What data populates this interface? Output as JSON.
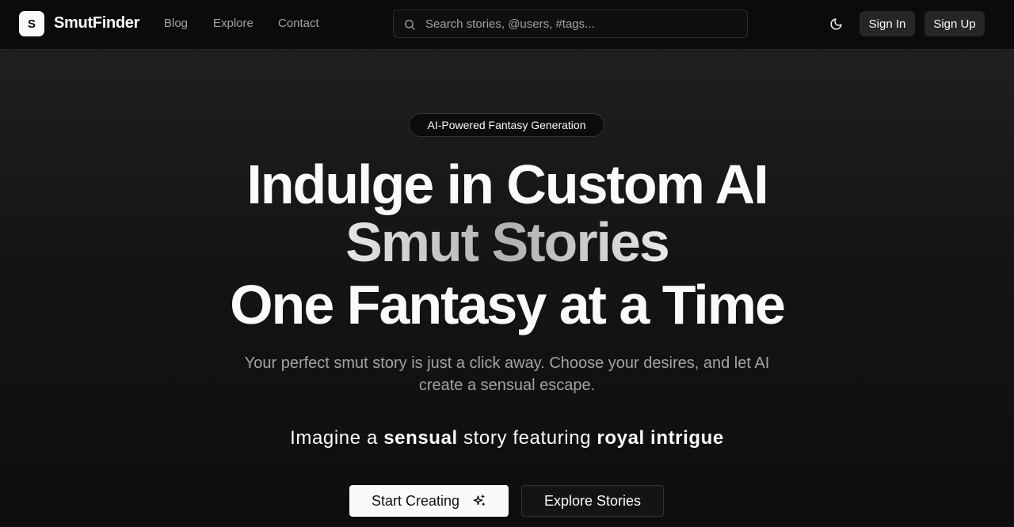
{
  "header": {
    "logo_letter": "S",
    "brand": "SmutFinder",
    "nav": [
      {
        "label": "Blog"
      },
      {
        "label": "Explore"
      },
      {
        "label": "Contact"
      }
    ],
    "search": {
      "placeholder": "Search stories, @users, #tags...",
      "icon": "search-icon"
    },
    "theme_toggle_icon": "moon-icon",
    "sign_in": "Sign In",
    "sign_up": "Sign Up"
  },
  "hero": {
    "badge": "AI-Powered Fantasy Generation",
    "headline_line1": "Indulge in Custom AI",
    "headline_line2": "Smut Stories",
    "headline_line3": "One Fantasy at a Time",
    "subtitle": "Your perfect smut story is just a click away. Choose your desires, and let AI create a sensual escape.",
    "imagine": {
      "prefix": "Imagine a ",
      "mood": "sensual",
      "middle": " story featuring ",
      "theme": "royal intrigue"
    },
    "cta_primary": "Start Creating",
    "cta_primary_icon": "sparkles-icon",
    "cta_secondary": "Explore Stories"
  },
  "colors": {
    "background": "#111111",
    "header_background": "#0b0b0b",
    "text": "#fafafa",
    "muted": "#a3a3a3",
    "button_dark": "#262626"
  }
}
